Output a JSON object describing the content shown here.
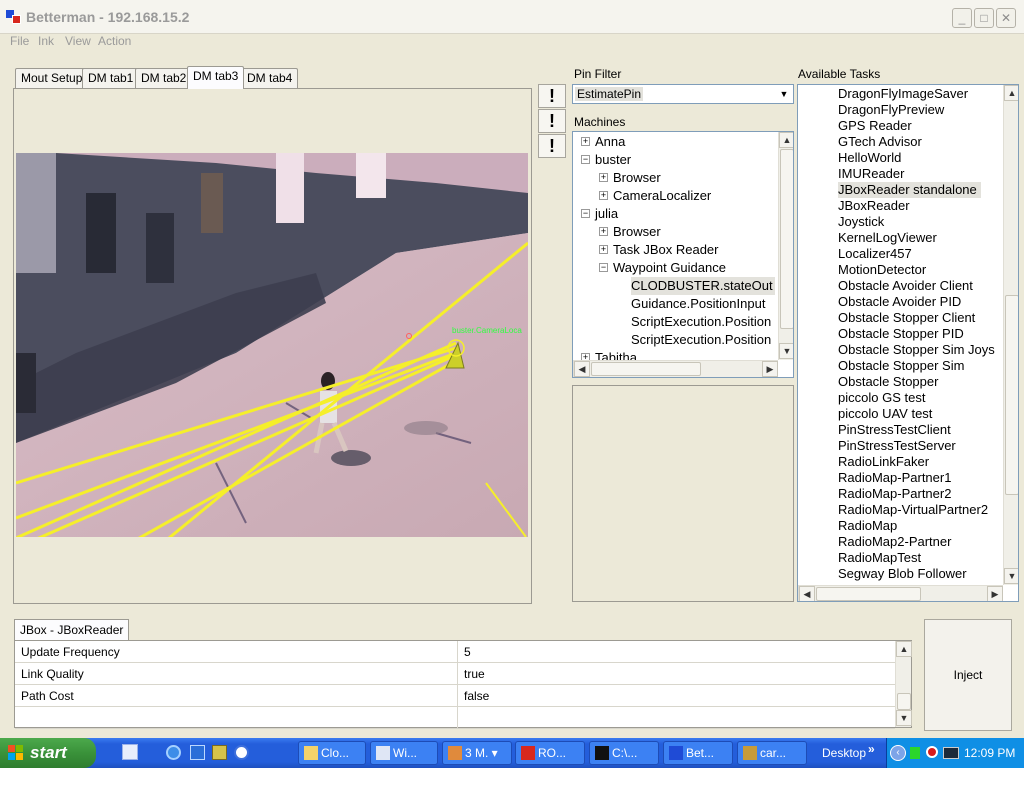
{
  "window": {
    "title": "Betterman - 192.168.15.2",
    "menus": [
      "File",
      "Ink",
      "View",
      "Action"
    ]
  },
  "tabs": [
    "Mout Setup",
    "DM tab1",
    "DM tab2",
    "DM tab3",
    "DM tab4"
  ],
  "active_tab": "DM tab3",
  "camera": {
    "overlay_label": "buster.CameraLoca"
  },
  "pin_filter": {
    "label": "Pin Filter",
    "value": "EstimatePin"
  },
  "machines": {
    "label": "Machines",
    "rows": [
      {
        "text": "Anna",
        "level": 0,
        "expander": "+"
      },
      {
        "text": "buster",
        "level": 0,
        "expander": "−"
      },
      {
        "text": "Browser",
        "level": 1,
        "expander": "+"
      },
      {
        "text": "CameraLocalizer",
        "level": 1,
        "expander": "+"
      },
      {
        "text": "julia",
        "level": 0,
        "expander": "−"
      },
      {
        "text": "Browser",
        "level": 1,
        "expander": "+"
      },
      {
        "text": "Task JBox Reader",
        "level": 1,
        "expander": "+"
      },
      {
        "text": "Waypoint Guidance",
        "level": 1,
        "expander": "−"
      },
      {
        "text": "CLODBUSTER.stateOut",
        "level": 2,
        "expander": "",
        "selected": true
      },
      {
        "text": "Guidance.PositionInput",
        "level": 2,
        "expander": ""
      },
      {
        "text": "ScriptExecution.Position",
        "level": 2,
        "expander": ""
      },
      {
        "text": "ScriptExecution.Position",
        "level": 2,
        "expander": ""
      },
      {
        "text": "Tabitha",
        "level": 0,
        "expander": "+"
      }
    ]
  },
  "available_tasks": {
    "label": "Available Tasks",
    "items": [
      "DragonFlyImageSaver",
      "DragonFlyPreview",
      "GPS Reader",
      "GTech Advisor",
      "HelloWorld",
      "IMUReader",
      "JBoxReader standalone",
      "JBoxReader",
      "Joystick",
      "KernelLogViewer",
      "Localizer457",
      "MotionDetector",
      "Obstacle Avoider Client",
      "Obstacle Avoider PID",
      "Obstacle Stopper Client",
      "Obstacle Stopper PID",
      "Obstacle Stopper Sim Joys",
      "Obstacle Stopper Sim",
      "Obstacle Stopper",
      "piccolo GS test",
      "piccolo UAV test",
      "PinStressTestClient",
      "PinStressTestServer",
      "RadioLinkFaker",
      "RadioMap-Partner1",
      "RadioMap-Partner2",
      "RadioMap-VirtualPartner2",
      "RadioMap",
      "RadioMap2-Partner",
      "RadioMapTest",
      "Segway Blob Follower"
    ],
    "selected": "JBoxReader standalone"
  },
  "property_tab": "JBox - JBoxReader",
  "properties": [
    {
      "name": "Update Frequency",
      "value": "5"
    },
    {
      "name": "Link Quality",
      "value": "true"
    },
    {
      "name": "Path Cost",
      "value": "false"
    },
    {
      "name": "",
      "value": ""
    }
  ],
  "inject_label": "Inject",
  "taskbar": {
    "start": "start",
    "buttons": [
      "Clo...",
      "Wi...",
      "3 M.",
      "RO...",
      "C:\\...",
      "Bet...",
      "car..."
    ],
    "desktop": "Desktop",
    "clock": "12:09 PM"
  },
  "colors": {
    "xp_blue": "#245edb",
    "start_green": "#3a923a",
    "overlay_yellow": "#f5ef2a",
    "selection": "#e3e2dc"
  }
}
